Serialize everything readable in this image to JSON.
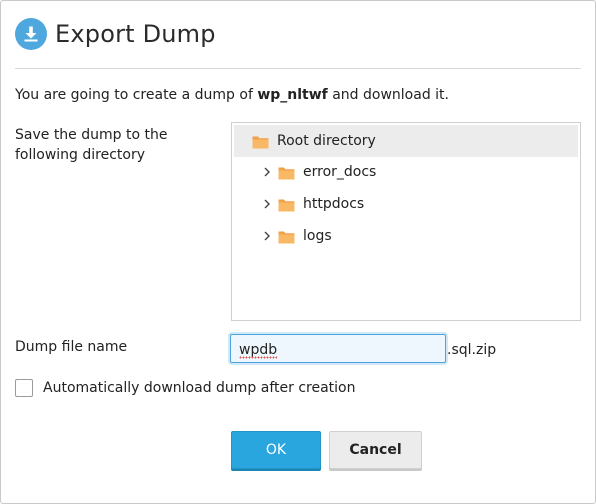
{
  "dialog": {
    "title": "Export Dump",
    "header_icon": "download-icon",
    "accent_color": "#28a6dd"
  },
  "intro": {
    "prefix": "You are going to create a dump of ",
    "database": "wp_nltwf",
    "suffix": " and download it."
  },
  "directory": {
    "label": "Save the dump to the following directory",
    "root": {
      "label": "Root directory",
      "icon": "folder-icon",
      "selected": true
    },
    "items": [
      {
        "label": "error_docs",
        "icon": "folder-icon",
        "expand_icon": "chevron-right-icon"
      },
      {
        "label": "httpdocs",
        "icon": "folder-icon",
        "expand_icon": "chevron-right-icon"
      },
      {
        "label": "logs",
        "icon": "folder-icon",
        "expand_icon": "chevron-right-icon"
      }
    ]
  },
  "file_name": {
    "label": "Dump file name",
    "value": "wpdb",
    "extension": ".sql.zip"
  },
  "auto_download": {
    "label": "Automatically download dump after creation",
    "checked": false
  },
  "buttons": {
    "ok": "OK",
    "cancel": "Cancel"
  }
}
